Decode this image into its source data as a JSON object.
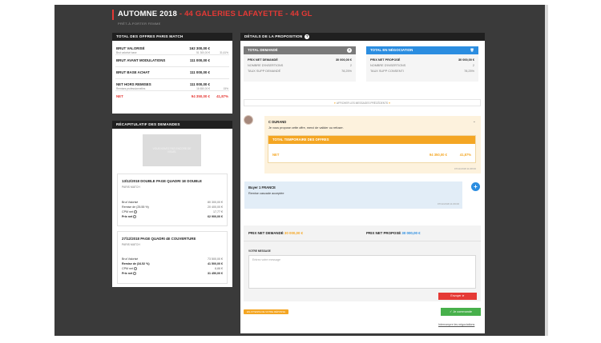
{
  "header": {
    "title_main": "AUTOMNE 2018",
    "title_sep": " - ",
    "title_accent": "44 GALERIES LAFAYETTE - 44 GL",
    "subtitle": "PRÊT-À-PORTER FEMME"
  },
  "totals": {
    "heading": "TOTAL DES OFFRES PARIS MATCH",
    "rows": [
      {
        "label": "BRUT VALORISÉ",
        "sublabel": "Brut valorisé base",
        "value": "162 300,00 €",
        "subvalue": "51 300,00 €",
        "subpct": "31,61%"
      },
      {
        "label": "BRUT AVANT MODULATIONS",
        "value": "111 000,00 €"
      },
      {
        "label": "BRUT BASE ACHAT",
        "value": "111 000,00 €"
      },
      {
        "label": "NET HORS REMISES",
        "sublabel": "Remises professionnelles",
        "value": "111 000,00 €",
        "subvalue": "16 650,00 €",
        "subpct": "15%"
      },
      {
        "label": "NET",
        "value": "94 350,00 €",
        "pct": "41,87%"
      }
    ]
  },
  "recap": {
    "heading": "RÉCAPITULATIF DES DEMANDES",
    "image_caption": "VOUS N'AVEZ PAS ENCORE DE VISUEL",
    "demands": [
      {
        "title": "13/12/2018 DOUBLE PAGE QUADRI 1E DOUBLE",
        "support": "PARIS MATCH",
        "rows": [
          {
            "k": "Brut Valorisé",
            "v": "80 300,00 €"
          },
          {
            "k": "Remise de (25.55 %)",
            "v": "20 400,00 €"
          },
          {
            "k": "CPM net",
            "v": "17,77 €"
          },
          {
            "k": "Prix net",
            "v": "62 900,00 €"
          }
        ]
      },
      {
        "title": "27/12/2018 PAGE QUADRI 4E COUVERTURE",
        "support": "PARIS MATCH",
        "rows": [
          {
            "k": "Brut Valorisé",
            "v": "73 500,00 €"
          },
          {
            "k": "Remise de (34.52 %)",
            "v": "41 500,00 €"
          },
          {
            "k": "CPM net",
            "v": "8,88 €"
          },
          {
            "k": "Prix net",
            "v": "31 450,00 €"
          }
        ]
      }
    ]
  },
  "detail": {
    "heading": "DÉTAILS DE LA PROPOSITION",
    "help_icon": "?",
    "requested": {
      "heading": "TOTAL DEMANDÉ",
      "color": "#7a7a7a",
      "rows": [
        {
          "k": "PRIX NET DEMANDÉ",
          "v": "30 000,00 €"
        },
        {
          "k": "NOMBRE D'INSERTIONS",
          "v": "2"
        },
        {
          "k": "TAUX SUPP DEMANDÉ",
          "v": "78,25%"
        }
      ]
    },
    "negotiation": {
      "heading": "TOTAL EN NÉGOCIATION",
      "color": "#2b8de0",
      "rows": [
        {
          "k": "PRIX NET PROPOSÉ",
          "v": "30 000,00 €"
        },
        {
          "k": "NOMBRE D'INSERTIONS",
          "v": "2"
        },
        {
          "k": "TAUX SUPP CONSENTI",
          "v": "78,25%"
        }
      ]
    },
    "earlier_messages": "AFFICHER LES MESSAGES PRÉCÉDENTS"
  },
  "messages": [
    {
      "author": "C DURAND",
      "text": "Je vous propose cette offre, merci de valider ou refuser.",
      "box_title": "TOTAL TEMPORAIRE DES OFFRES",
      "net_label": "NET",
      "net_value": "94 350,00 €",
      "net_pct": "41,87%",
      "time": "07/11/2018 11:08:00"
    },
    {
      "author": "Buyer 1 FRANCE",
      "text": "Remise cascade acceptée",
      "time": "07/11/2018 11:09:00"
    }
  ],
  "compose": {
    "asked_label": "PRIX NET DEMANDÉ",
    "asked_value": "30 000,00 €",
    "proposed_label": "PRIX NET PROPOSÉ",
    "proposed_value": "30 000,00 €",
    "message_label": "VOTRE MESSAGE",
    "placeholder": "Entrez votre message",
    "send_label": "Envoyer"
  },
  "footer": {
    "accept_tag": "EN ATTENTE DE VOTRE RÉPONSE",
    "accept_label": "Je commande",
    "cancel_label": "Interrompre les négociations"
  },
  "colors": {
    "accent_red": "#e53935",
    "orange": "#f4a623",
    "blue": "#2b8de0",
    "green": "#47b04b"
  }
}
